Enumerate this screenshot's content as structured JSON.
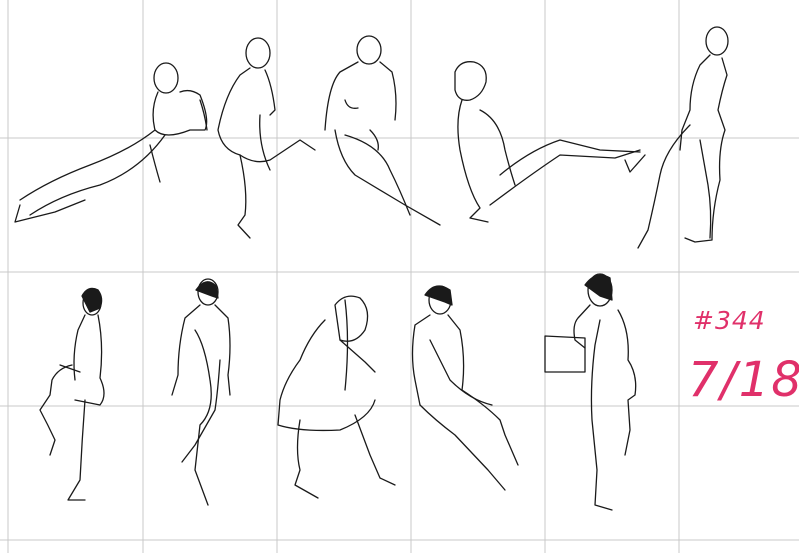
{
  "notes": {
    "number": "#344",
    "date": "7/18"
  },
  "colors": {
    "background": "#ffffff",
    "grid": "#c8c8c8",
    "ink": "#1a1a1a",
    "annotation": "#e0306a"
  }
}
